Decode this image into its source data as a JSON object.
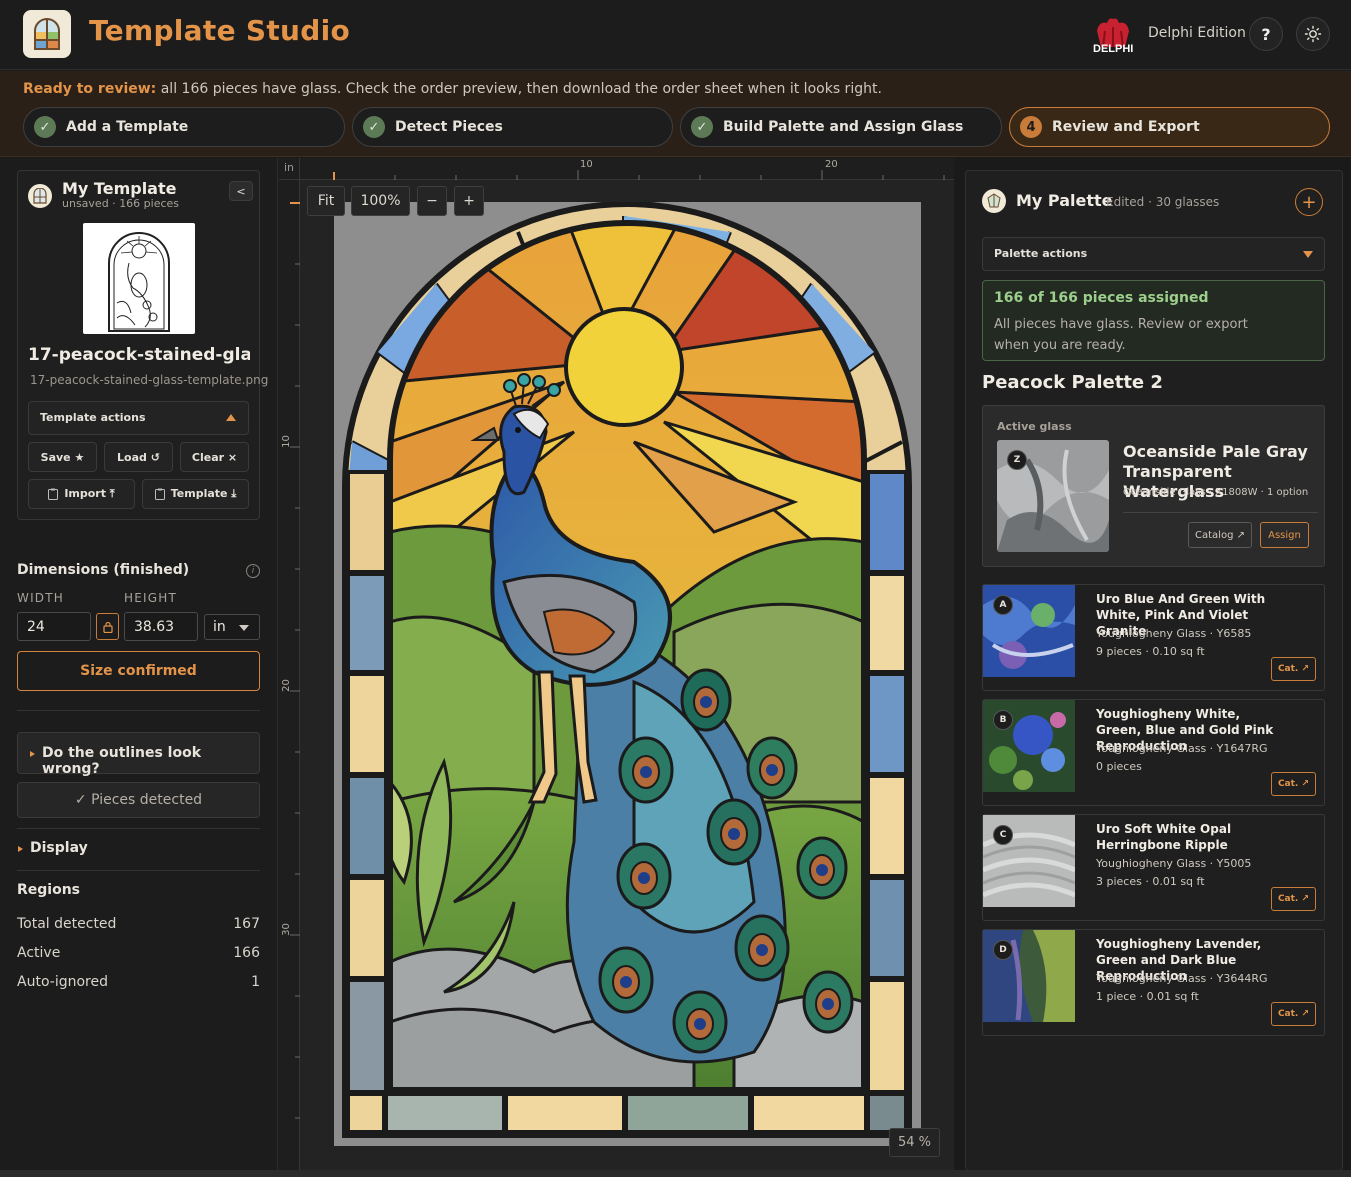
{
  "header": {
    "app_title": "Template Studio",
    "brand": "DELPHI",
    "edition": "Delphi Edition",
    "help_label": "?",
    "theme_icon": "sun-icon",
    "logo_icon": "window-logo-icon"
  },
  "status": {
    "ready_bold": "Ready to review:",
    "ready_text": " all 166 pieces have glass. Check the order preview, then download the order sheet when it looks right."
  },
  "steps": [
    {
      "label": "Add a Template",
      "marker": "✓",
      "state": "done"
    },
    {
      "label": "Detect Pieces",
      "marker": "✓",
      "state": "done"
    },
    {
      "label": "Build Palette and Assign Glass",
      "marker": "✓",
      "state": "done"
    },
    {
      "label": "Review and Export",
      "marker": "4",
      "state": "active"
    }
  ],
  "template": {
    "title": "My Template",
    "status": "unsaved",
    "pieces": "166 pieces",
    "collapse_label": "<",
    "file_name": "17-peacock-stained-gla...",
    "file_full": "17-peacock-stained-glass-template.png",
    "actions_label": "Template actions",
    "save": "Save ★",
    "load": "Load ↺",
    "clear": "Clear ×",
    "import": "Import ⤒",
    "template_dl": "Template ⤓"
  },
  "dimensions": {
    "title": "Dimensions (finished)",
    "width_label": "WIDTH",
    "height_label": "HEIGHT",
    "width": "24",
    "height": "38.63",
    "unit": "in",
    "confirm_label": "Size confirmed"
  },
  "outlines": {
    "question": "Do the outlines look wrong?",
    "detected": "✓ Pieces detected"
  },
  "display": {
    "label": "Display"
  },
  "regions": {
    "title": "Regions",
    "rows": [
      {
        "label": "Total detected",
        "value": "167"
      },
      {
        "label": "Active",
        "value": "166"
      },
      {
        "label": "Auto-ignored",
        "value": "1"
      }
    ]
  },
  "canvas": {
    "ruler_unit": "in",
    "ruler_top_labels": [
      "10",
      "20"
    ],
    "ruler_left_labels": [
      "10",
      "20",
      "30"
    ],
    "fit_label": "Fit",
    "zoom_label": "100%",
    "zoom_out": "−",
    "zoom_in": "+",
    "view_pct": "54 %"
  },
  "palette": {
    "title": "My Palette",
    "edited": "Edited",
    "count": "30 glasses",
    "add_label": "+",
    "actions_label": "Palette actions",
    "assigned_title": "166 of 166 pieces assigned",
    "assigned_body": "All pieces have glass. Review or export when you are ready.",
    "name": "Peacock Palette 2",
    "active_label": "Active glass",
    "active": {
      "code": "Z",
      "name": "Oceanside Pale Gray Transparent Waterglass",
      "meta": "Oceanside Glass · X1808W · 1 option",
      "catalog": "Catalog ↗",
      "assign": "Assign"
    },
    "glasses": [
      {
        "code": "A",
        "name": "Uro Blue And Green With White, Pink And Violet Granite",
        "maker": "Youghiogheny Glass · Y6585",
        "usage": "9 pieces · 0.10 sq ft",
        "cat": "Cat. ↗"
      },
      {
        "code": "B",
        "name": "Youghiogheny White, Green, Blue and Gold Pink Reproduction",
        "maker": "Youghiogheny Glass · Y1647RG",
        "usage": "0 pieces",
        "cat": "Cat. ↗"
      },
      {
        "code": "C",
        "name": "Uro Soft White Opal Herringbone Ripple",
        "maker": "Youghiogheny Glass · Y5005",
        "usage": "3 pieces · 0.01 sq ft",
        "cat": "Cat. ↗"
      },
      {
        "code": "D",
        "name": "Youghiogheny Lavender, Green and Dark Blue Reproduction",
        "maker": "Youghiogheny Glass · Y3644RG",
        "usage": "1 piece · 0.01 sq ft",
        "cat": "Cat. ↗"
      }
    ]
  }
}
